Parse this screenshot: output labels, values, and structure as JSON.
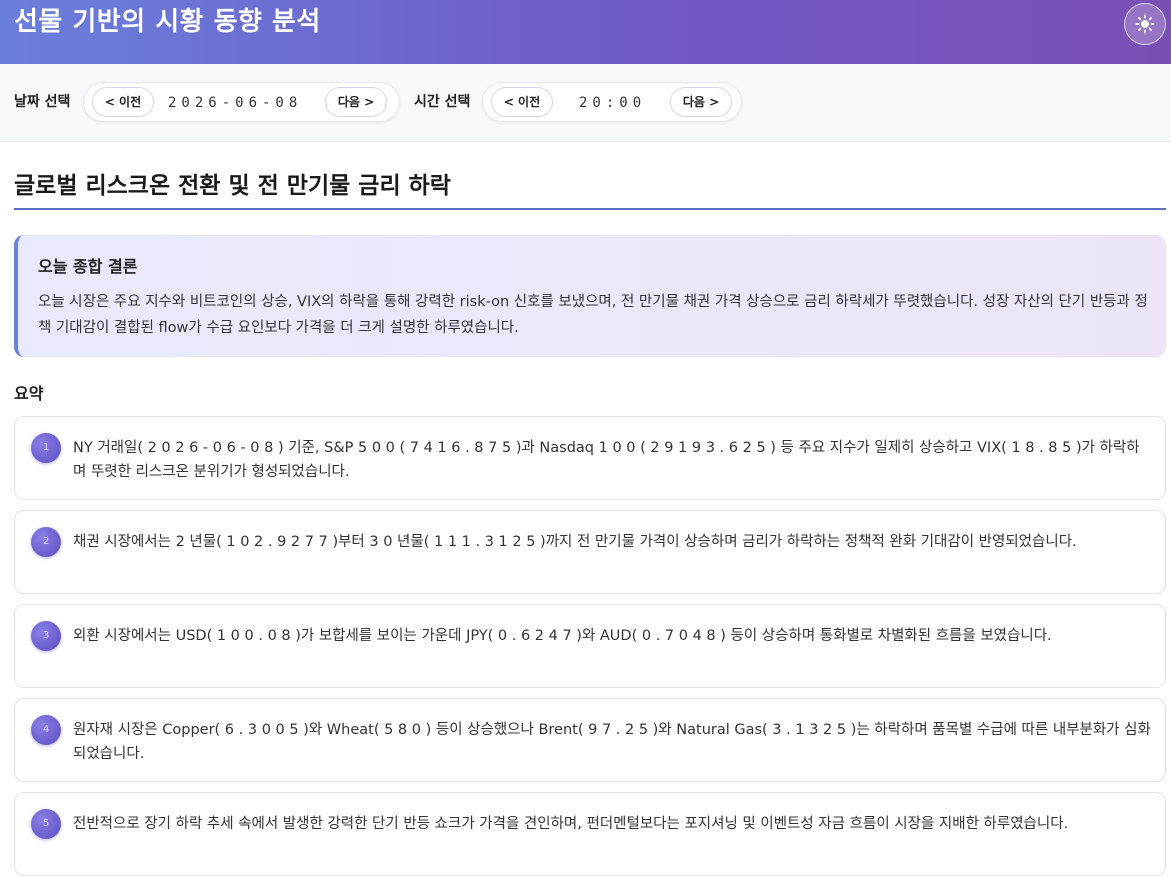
{
  "header": {
    "title": "선물 기반의 시황 동향 분석",
    "theme_icon": "sun-icon"
  },
  "controls": {
    "date_label": "날짜 선택",
    "date_value": "2026-06-08",
    "time_label": "시간 선택",
    "time_value": "20:00",
    "prev_label": "< 이전",
    "next_label": "다음 >"
  },
  "report": {
    "title": "글로벌 리스크온 전환 및 전 만기물 금리 하락",
    "conclusion": {
      "title": "오늘 종합 결론",
      "text": "오늘 시장은 주요 지수와 비트코인의 상승, VIX의 하락을 통해 강력한 risk-on 신호를 보냈으며, 전 만기물 채권 가격 상승으로 금리 하락세가 뚜렷했습니다. 성장 자산의 단기 반등과 정책 기대감이 결합된 flow가 수급 요인보다 가격을 더 크게 설명한 하루였습니다."
    },
    "summary_heading": "요약",
    "summary": [
      {
        "num": "1",
        "text": "NY 거래일( 2 0 2 6 - 0 6 - 0 8 ) 기준, S&P 5 0 0 ( 7 4 1 6 . 8 7 5 )과 Nasdaq 1 0 0 ( 2 9 1 9 3 . 6 2 5 ) 등 주요 지수가 일제히 상승하고 VIX( 1 8 . 8 5 )가 하락하며 뚜렷한 리스크온 분위기가 형성되었습니다."
      },
      {
        "num": "2",
        "text": "채권 시장에서는 2 년물( 1 0 2 . 9 2 7 7 )부터 3 0 년물( 1 1 1 . 3 1 2 5 )까지 전 만기물 가격이 상승하며 금리가 하락하는 정책적 완화 기대감이 반영되었습니다."
      },
      {
        "num": "3",
        "text": "외환 시장에서는 USD( 1 0 0 . 0 8 )가 보합세를 보이는 가운데 JPY( 0 . 6 2 4 7 )와 AUD( 0 . 7 0 4 8 ) 등이 상승하며 통화별로 차별화된 흐름을 보였습니다."
      },
      {
        "num": "4",
        "text": "원자재 시장은 Copper( 6 . 3 0 0 5 )와 Wheat( 5 8 0 ) 등이 상승했으나 Brent( 9 7 . 2 5 )와 Natural Gas( 3 . 1 3 2 5 )는 하락하며 품목별 수급에 따른 내부분화가 심화되었습니다."
      },
      {
        "num": "5",
        "text": "전반적으로 장기 하락 추세 속에서 발생한 강력한 단기 반등 쇼크가 가격을 견인하며, 펀더멘털보다는 포지셔닝 및 이벤트성 자금 흐름이 시장을 지배한 하루였습니다."
      }
    ]
  },
  "colors": {
    "header_gradient_start": "#6a7fdb",
    "header_gradient_end": "#7a4fb3",
    "accent": "#5d6fc2",
    "badge": "#5a4cc0"
  }
}
